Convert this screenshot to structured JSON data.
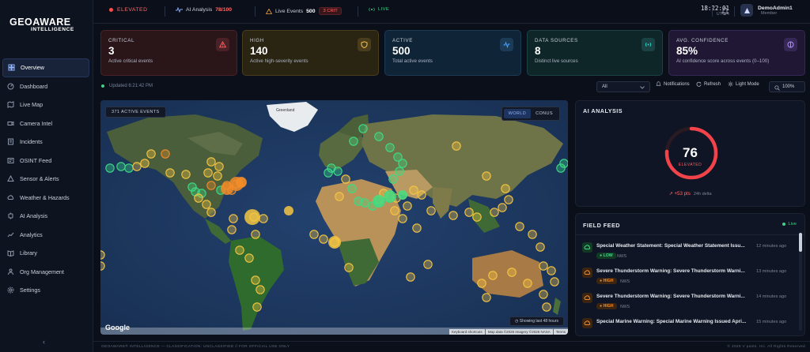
{
  "brand": {
    "line1": "GEOAWARE",
    "line2": "INTELLIGENCE"
  },
  "sidebar": {
    "items": [
      {
        "label": "Overview",
        "icon": "overview-icon",
        "active": true
      },
      {
        "label": "Dashboard",
        "icon": "dashboard-icon"
      },
      {
        "label": "Live Map",
        "icon": "map-icon"
      },
      {
        "label": "Camera Intel",
        "icon": "camera-icon"
      },
      {
        "label": "Incidents",
        "icon": "incident-icon"
      },
      {
        "label": "OSINT Feed",
        "icon": "osint-icon"
      },
      {
        "label": "Sensor & Alerts",
        "icon": "sensor-icon"
      },
      {
        "label": "Weather & Hazards",
        "icon": "weather-icon"
      },
      {
        "label": "AI Analysis",
        "icon": "ai-icon"
      },
      {
        "label": "Analytics",
        "icon": "analytics-icon"
      },
      {
        "label": "Library",
        "icon": "library-icon"
      },
      {
        "label": "Org Management",
        "icon": "org-icon"
      },
      {
        "label": "Settings",
        "icon": "settings-icon"
      }
    ],
    "collapse_glyph": "‹"
  },
  "topbar": {
    "status_label": "ELEVATED",
    "ai_label": "AI Analysis",
    "ai_score": "78/100",
    "events_label": "Live Events",
    "events_count": "500",
    "events_crit": "3 CRIT",
    "live_label": "LIVE",
    "time": "18:22:01",
    "timezone": "UTC-4",
    "user_name": "DemoAdmin1",
    "user_role": "Member"
  },
  "cards": [
    {
      "label": "CRITICAL",
      "value": "3",
      "sub": "Active critical events",
      "icon": "warning-icon",
      "accent": "#ff5b5b"
    },
    {
      "label": "HIGH",
      "value": "140",
      "sub": "Active high-severity events",
      "icon": "shield-icon",
      "accent": "#f5c542"
    },
    {
      "label": "ACTIVE",
      "value": "500",
      "sub": "Total active events",
      "icon": "activity-icon",
      "accent": "#4fa3ff"
    },
    {
      "label": "DATA SOURCES",
      "value": "8",
      "sub": "Distinct live sources",
      "icon": "broadcast-icon",
      "accent": "#2fd3c3"
    },
    {
      "label": "AVG. CONFIDENCE",
      "value": "85%",
      "sub": "AI confidence score across events (0–100)",
      "icon": "brain-icon",
      "accent": "#b08cff"
    }
  ],
  "toolbar": {
    "updated": "Updated 6:21:42 PM",
    "filter_value": "All",
    "notifications": "Notifications",
    "refresh": "Refresh",
    "light_mode": "Light Mode",
    "zoom": "100%"
  },
  "map": {
    "events_badge": "371 ACTIVE EVENTS",
    "view_world": "WORLD",
    "view_conus": "CONUS",
    "greenland_label": "Greenland",
    "google_logo": "Google",
    "window_label": "Showing last 48 hours",
    "attrib_shortcuts": "Keyboard shortcuts",
    "attrib_data": "Map data ©2026 Imagery ©2026 NASA",
    "attrib_terms": "Terms",
    "colors": {
      "low": "#3ddc84",
      "med": "#f5c542",
      "high": "#f28c28",
      "ocean": "#1f3a63",
      "land": "#3f5a3a"
    }
  },
  "ai_analysis": {
    "title": "AI ANALYSIS",
    "score": 76,
    "score_text": "76",
    "level": "ELEVATED",
    "delta": "+53 pts",
    "window": "24h delta"
  },
  "feed": {
    "title": "FIELD FEED",
    "live": "Live",
    "items": [
      {
        "title": "Special Weather Statement: Special Weather Statement Issu...",
        "time": "12 minutes ago",
        "severity": "LOW",
        "source": "NWS",
        "sev_color": "#3ddc84",
        "sev_bg": "#123a25",
        "icon_bg": "#123a25"
      },
      {
        "title": "Severe Thunderstorm Warning: Severe Thunderstorm Warni...",
        "time": "13 minutes ago",
        "severity": "HIGH",
        "source": "NWS",
        "sev_color": "#f28c28",
        "sev_bg": "#3a2412",
        "icon_bg": "#3a2412"
      },
      {
        "title": "Severe Thunderstorm Warning: Severe Thunderstorm Warni...",
        "time": "14 minutes ago",
        "severity": "HIGH",
        "source": "NWS",
        "sev_color": "#f28c28",
        "sev_bg": "#3a2412",
        "icon_bg": "#3a2412"
      },
      {
        "title": "Special Marine Warning: Special Marine Warning Issued Apri...",
        "time": "15 minutes ago",
        "severity": "",
        "source": "",
        "sev_color": "#f28c28",
        "sev_bg": "#3a2412",
        "icon_bg": "#3a2412"
      }
    ]
  },
  "footer": {
    "left": "GEOAWARE® INTELLIGENCE — CLASSIFICATION: UNCLASSIFIED // FOR OFFICIAL USE ONLY",
    "right": "© 2026 V pasts, Inc. All Rights Reserved"
  }
}
